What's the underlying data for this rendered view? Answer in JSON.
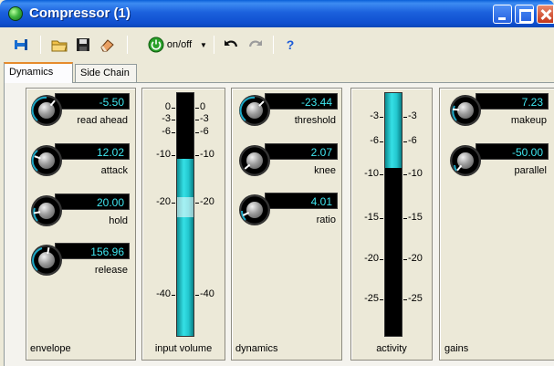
{
  "window": {
    "title": "Compressor (1)"
  },
  "toolbar": {
    "items": [
      "pin-icon",
      "open-folder-icon",
      "save-icon",
      "eraser-icon",
      "power-icon",
      "undo-icon",
      "redo-icon",
      "help-icon"
    ],
    "onoff_label": "on/off",
    "help_label": "?"
  },
  "tabs": [
    {
      "label": "Dynamics",
      "active": true
    },
    {
      "label": "Side Chain",
      "active": false
    }
  ],
  "envelope": {
    "label": "envelope",
    "knobs": [
      {
        "name": "read ahead",
        "value": "-5.50"
      },
      {
        "name": "attack",
        "value": "12.02"
      },
      {
        "name": "hold",
        "value": "20.00"
      },
      {
        "name": "release",
        "value": "156.96"
      }
    ]
  },
  "input_volume": {
    "label": "input volume",
    "scale_left": [
      "0",
      "-3",
      "-6",
      "-10",
      "-20",
      "-40"
    ],
    "scale_right": [
      "0",
      "-3",
      "-6",
      "-10",
      "-20",
      "-40"
    ],
    "level_db": -10,
    "handle_db": -20
  },
  "dynamics": {
    "label": "dynamics",
    "knobs": [
      {
        "name": "threshold",
        "value": "-23.44"
      },
      {
        "name": "knee",
        "value": "2.07"
      },
      {
        "name": "ratio",
        "value": "4.01"
      }
    ]
  },
  "activity": {
    "label": "activity",
    "scale_left": [
      "-3",
      "-6",
      "-10",
      "-15",
      "-20",
      "-25"
    ],
    "scale_right": [
      "-3",
      "-6",
      "-10",
      "-15",
      "-20",
      "-25"
    ],
    "level_db": -10
  },
  "gains": {
    "label": "gains",
    "knobs": [
      {
        "name": "makeup",
        "value": "7.23"
      },
      {
        "name": "parallel",
        "value": "-50.00"
      }
    ]
  },
  "colors": {
    "accent": "#3fe6f0",
    "titlebar": "#0f4fcf",
    "meter_fill": "#23c7ce"
  }
}
